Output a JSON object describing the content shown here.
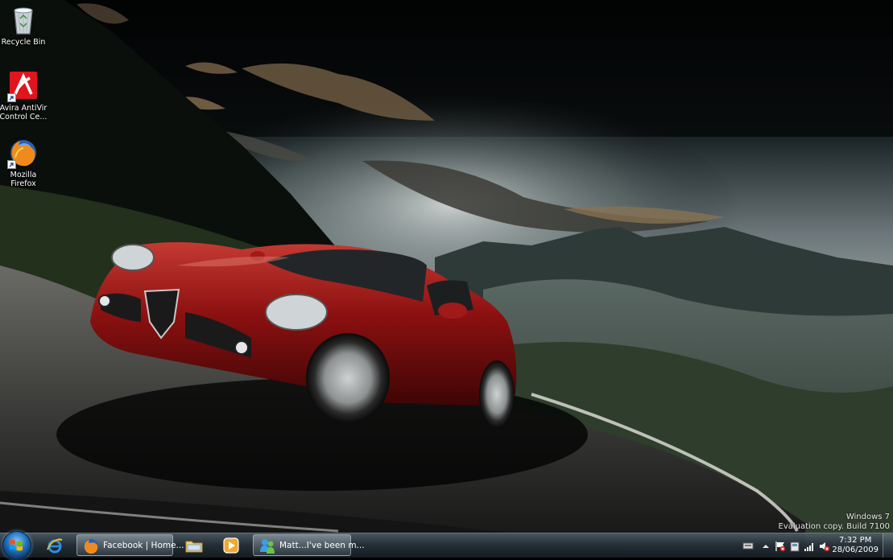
{
  "desktop": {
    "icons": [
      {
        "label": "Recycle Bin",
        "icon": "recycle-bin-icon"
      },
      {
        "label": "Avira AntiVir Control Ce...",
        "icon": "avira-icon"
      },
      {
        "label": "Mozilla Firefox",
        "icon": "firefox-icon"
      }
    ],
    "watermark": {
      "line1": "Windows 7",
      "line2": "Evaluation copy. Build 7100"
    }
  },
  "taskbar": {
    "start": {
      "icon": "windows-logo-icon"
    },
    "pinned": [
      {
        "icon": "internet-explorer-icon"
      },
      {
        "icon": "windows-explorer-icon"
      },
      {
        "icon": "media-player-icon"
      }
    ],
    "windows": [
      {
        "label": "Facebook | Home...",
        "icon": "firefox-icon"
      },
      {
        "label": "Matt...I've been m...",
        "icon": "messenger-icon"
      }
    ],
    "tray": {
      "icons": [
        "show-hidden-icons-icon",
        "action-center-flag-icon",
        "device-icon",
        "network-signal-icon",
        "volume-icon"
      ],
      "time": "7:32 PM",
      "date": "28/06/2009"
    }
  },
  "colors": {
    "car": "#8b1010",
    "sky": "#1a2428",
    "taskbar": "#2a343a"
  }
}
